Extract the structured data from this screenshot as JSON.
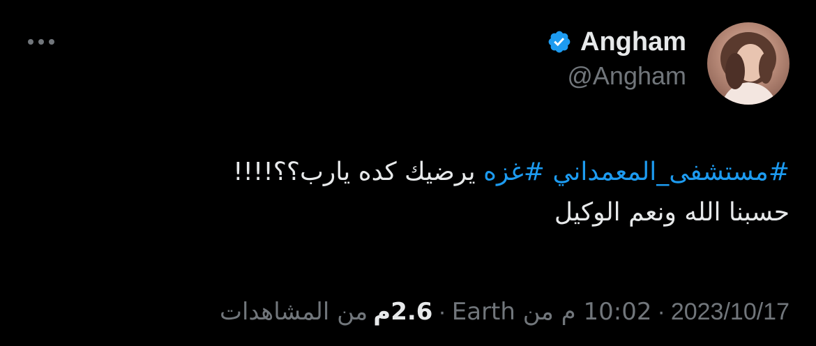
{
  "tweet_header": {
    "display_name": "Angham",
    "handle": "@Angham",
    "avatar_icon": "profile-photo",
    "verified_icon": "verified-badge-icon",
    "more_icon": "more-options-icon"
  },
  "tweet_body": {
    "hashtag_1": "#مستشفى_المعمداني",
    "hashtag_2": "#غزه",
    "line1_rest": "يرضيك كده يارب؟؟!!!!",
    "line2": "حسبنا الله ونعم الوكيل"
  },
  "meta": {
    "date": "2023/10/17",
    "time_location": "10:02 م من Earth",
    "separator": "·",
    "views_count": "2.6م",
    "views_label": "من المشاهدات"
  },
  "colors": {
    "background": "#000000",
    "text": "#e7e9ea",
    "secondary": "#71767b",
    "accent": "#1d9bf0"
  }
}
